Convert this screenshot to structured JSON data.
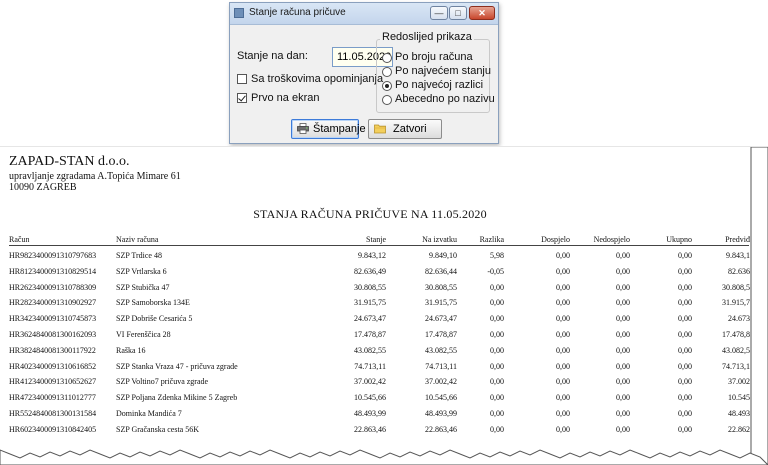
{
  "dialog": {
    "title": "Stanje računa pričuve",
    "min_glyph": "—",
    "max_glyph": "□",
    "close_glyph": "✕",
    "state_label": "Stanje na dan:",
    "date_value": "11.05.2020",
    "with_costs_label": "Sa troškovima opominjanja",
    "with_costs_checked": false,
    "first_on_screen_label": "Prvo na ekran",
    "first_on_screen_checked": true,
    "order_group_title": "Redoslijed prikaza",
    "order_options": [
      "Po broju računa",
      "Po najvećem stanju",
      "Po najvećoj razlici",
      "Abecedno po nazivu"
    ],
    "order_selected_index": 2,
    "print_button": "Štampanje",
    "close_button": "Zatvori"
  },
  "report": {
    "company": "ZAPAD-STAN d.o.o.",
    "address_line1": "upravljanje zgradama A.Topića Mimare 61",
    "address_line2": "10090 ZAGREB",
    "title": "STANJA RAČUNA PRIČUVE NA 11.05.2020",
    "columns": [
      "Račun",
      "Naziv računa",
      "Stanje",
      "Na izvatku",
      "Razlika",
      "Dospjelo",
      "Nedospjelo",
      "Ukupno",
      "Predviđ"
    ],
    "rows": [
      [
        "HR9823400091310797683",
        "SZP Trdice 48",
        "9.843,12",
        "9.849,10",
        "5,98",
        "0,00",
        "0,00",
        "0,00",
        "9.843,1"
      ],
      [
        "HR8123400091310829514",
        "SZP Vrtlarska 6",
        "82.636,49",
        "82.636,44",
        "-0,05",
        "0,00",
        "0,00",
        "0,00",
        "82.636"
      ],
      [
        "HR2623400091310788309",
        "SZP Stubička 47",
        "30.808,55",
        "30.808,55",
        "0,00",
        "0,00",
        "0,00",
        "0,00",
        "30.808,5"
      ],
      [
        "HR2823400091310902927",
        "SZP Samoborska 134E",
        "31.915,75",
        "31.915,75",
        "0,00",
        "0,00",
        "0,00",
        "0,00",
        "31.915,7"
      ],
      [
        "HR3423400091310745873",
        "SZP Dobriše Cesarića 5",
        "24.673,47",
        "24.673,47",
        "0,00",
        "0,00",
        "0,00",
        "0,00",
        "24.673"
      ],
      [
        "HR3624840081300162093",
        "VI Ferenščica 28",
        "17.478,87",
        "17.478,87",
        "0,00",
        "0,00",
        "0,00",
        "0,00",
        "17.478,8"
      ],
      [
        "HR3824840081300117922",
        "Raška 16",
        "43.082,55",
        "43.082,55",
        "0,00",
        "0,00",
        "0,00",
        "0,00",
        "43.082,5"
      ],
      [
        "HR4023400091310616852",
        "SZP Stanka Vraza 47 - pričuva zgrade",
        "74.713,11",
        "74.713,11",
        "0,00",
        "0,00",
        "0,00",
        "0,00",
        "74.713,1"
      ],
      [
        "HR4123400091310652627",
        "SZP Voltino7 pričuva zgrade",
        "37.002,42",
        "37.002,42",
        "0,00",
        "0,00",
        "0,00",
        "0,00",
        "37.002"
      ],
      [
        "HR4723400091311012777",
        "SZP Poljana Zdenka Mikine 5 Zagreb",
        "10.545,66",
        "10.545,66",
        "0,00",
        "0,00",
        "0,00",
        "0,00",
        "10.545"
      ],
      [
        "HR5524840081300131584",
        "Dominka Mandića 7",
        "48.493,99",
        "48.493,99",
        "0,00",
        "0,00",
        "0,00",
        "0,00",
        "48.493"
      ],
      [
        "HR6023400091310842405",
        "SZP Gračanska cesta 56K",
        "22.863,46",
        "22.863,46",
        "0,00",
        "0,00",
        "0,00",
        "0,00",
        "22.862"
      ]
    ]
  }
}
